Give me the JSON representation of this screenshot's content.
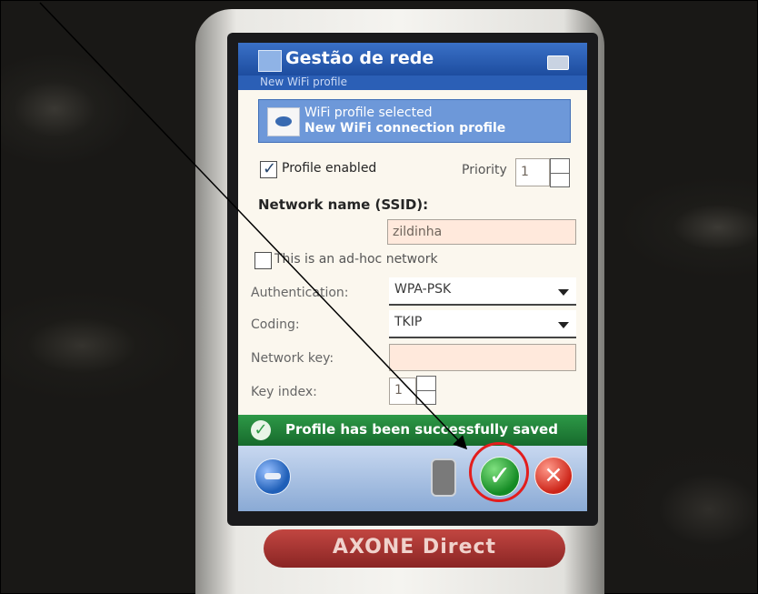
{
  "screen": {
    "title": "Gestão de rede",
    "subtitle": "New WiFi profile",
    "banner": {
      "line1": "WiFi profile selected",
      "line2": "New WiFi connection profile"
    },
    "profile_enabled_label": "Profile enabled",
    "priority_label": "Priority",
    "priority_value": "1",
    "ssid_label": "Network name (SSID):",
    "ssid_value": "zildinha",
    "adhoc_label": "This is an ad-hoc network",
    "authentication_label": "Authentication:",
    "authentication_value": "WPA-PSK",
    "coding_label": "Coding:",
    "coding_value": "TKIP",
    "network_key_label": "Network key:",
    "key_index_label": "Key index:",
    "key_index_value": "1",
    "success_message": "Profile has been successfully saved"
  },
  "device": {
    "brand": "AXONE Direct"
  },
  "icons": [
    "app-icon",
    "keyboard-icon",
    "wifi-profile-icon",
    "success-check-icon",
    "globe-icon",
    "device-icon",
    "ok-check-icon",
    "cancel-x-icon"
  ],
  "colors": {
    "titlebar": "#1d4d9f",
    "success_bar": "#24843b",
    "annotation": "#e31d1d"
  }
}
